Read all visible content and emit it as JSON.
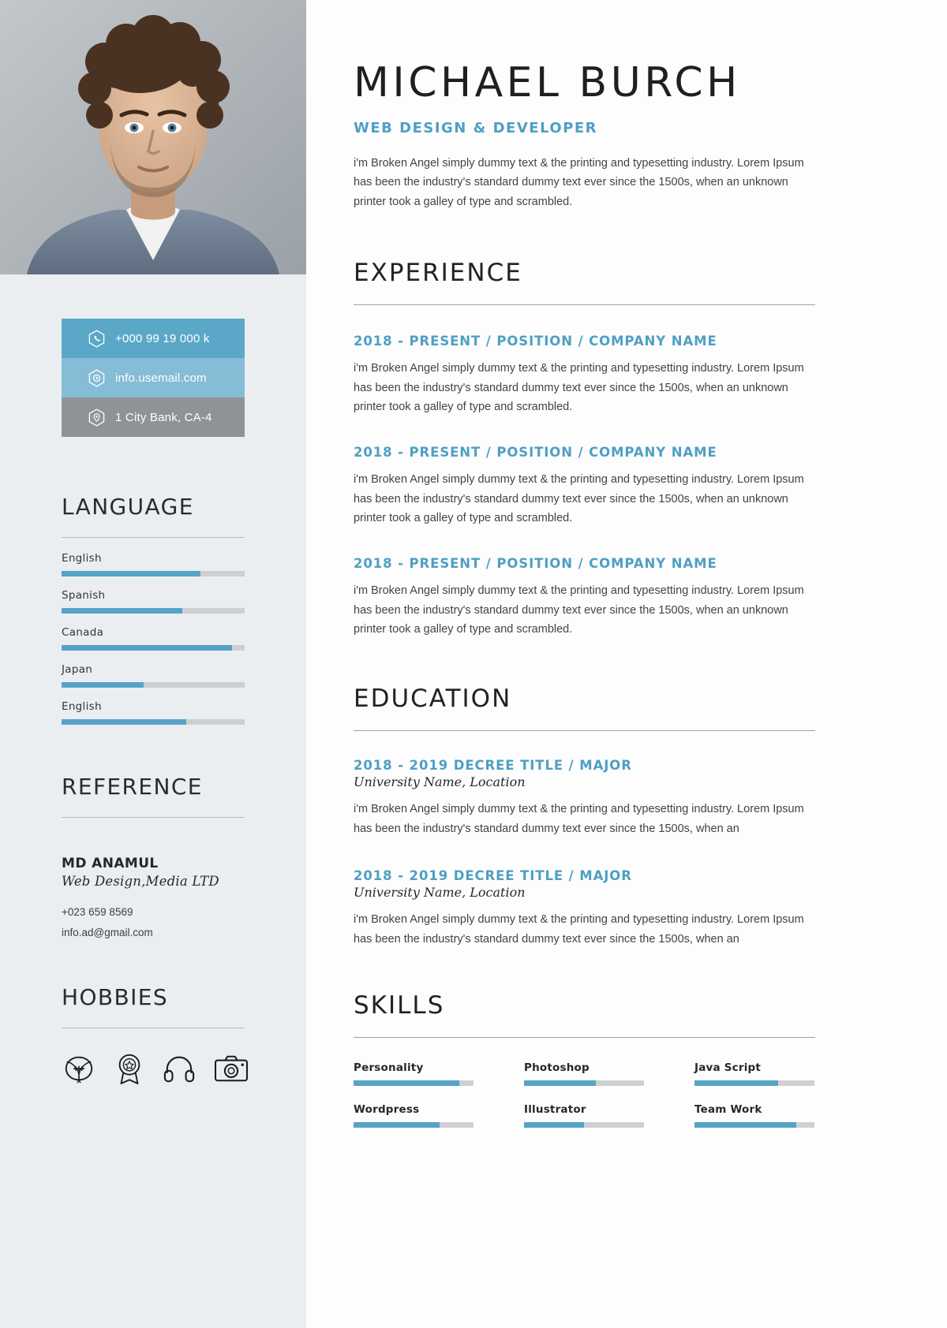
{
  "header": {
    "name": "MICHAEL BURCH",
    "role": "WEB DESIGN & DEVELOPER",
    "intro": "i'm Broken Angel simply dummy text & the printing and typesetting industry. Lorem Ipsum has been the industry's standard dummy text ever since the 1500s, when an unknown printer took a galley of type and scrambled."
  },
  "contact": {
    "items": [
      {
        "icon": "phone-hex-icon",
        "value": "+000 99 19 000 k",
        "color": "#5aa7c8"
      },
      {
        "icon": "mail-hex-icon",
        "value": "info.usemail.com",
        "color": "#85bcd6"
      },
      {
        "icon": "location-hex-icon",
        "value": "1 City Bank, CA-4",
        "color": "#8e9396"
      }
    ]
  },
  "language": {
    "title": "LANGUAGE",
    "items": [
      {
        "label": "English",
        "percent": 76
      },
      {
        "label": "Spanish",
        "percent": 66
      },
      {
        "label": "Canada",
        "percent": 93
      },
      {
        "label": "Japan",
        "percent": 45
      },
      {
        "label": "English",
        "percent": 68
      }
    ]
  },
  "reference": {
    "title": "REFERENCE",
    "name": "MD ANAMUL",
    "company": "Web Design,Media LTD",
    "phone": "+023 659 8569",
    "email": "info.ad@gmail.com"
  },
  "hobbies": {
    "title": "HOBBIES",
    "icons": [
      "football-icon",
      "medal-badge-icon",
      "headphones-icon",
      "camera-icon"
    ]
  },
  "experience": {
    "title": "EXPERIENCE",
    "items": [
      {
        "heading": "2018 - PRESENT / POSITION / COMPANY NAME",
        "description": "i'm Broken Angel simply dummy text & the printing and typesetting industry. Lorem Ipsum has been the industry's standard dummy text ever since the 1500s, when an unknown printer took a galley of type and scrambled."
      },
      {
        "heading": "2018 - PRESENT / POSITION / COMPANY NAME",
        "description": "i'm Broken Angel simply dummy text & the printing and typesetting industry. Lorem Ipsum has been the industry's standard dummy text ever since the 1500s, when an unknown printer took a galley of type and scrambled."
      },
      {
        "heading": "2018 - PRESENT / POSITION / COMPANY NAME",
        "description": "i'm Broken Angel simply dummy text & the printing and typesetting industry. Lorem Ipsum has been the industry's standard dummy text ever since the 1500s, when an unknown printer took a galley of type and scrambled."
      }
    ]
  },
  "education": {
    "title": "EDUCATION",
    "items": [
      {
        "heading": "2018 - 2019 DECREE TITLE / MAJOR",
        "subheading": "University Name, Location",
        "description": "i'm Broken Angel simply dummy text & the printing and typesetting industry. Lorem Ipsum has been the industry's standard dummy text ever since the 1500s, when an"
      },
      {
        "heading": "2018 - 2019 DECREE TITLE / MAJOR",
        "subheading": "University Name, Location",
        "description": "i'm Broken Angel simply dummy text & the printing and typesetting industry. Lorem Ipsum has been the industry's standard dummy text ever since the 1500s, when an"
      }
    ]
  },
  "skills": {
    "title": "SKILLS",
    "items": [
      {
        "label": "Personality",
        "percent": 88
      },
      {
        "label": "Photoshop",
        "percent": 60
      },
      {
        "label": "Java Script",
        "percent": 70
      },
      {
        "label": "Wordpress",
        "percent": 72
      },
      {
        "label": "Illustrator",
        "percent": 50
      },
      {
        "label": "Team Work",
        "percent": 85
      }
    ]
  },
  "colors": {
    "accent": "#4f9fc4",
    "bar_fill": "#56a3c6",
    "bar_track": "#cdd0d2",
    "sidebar_bg": "#eaeef1"
  }
}
